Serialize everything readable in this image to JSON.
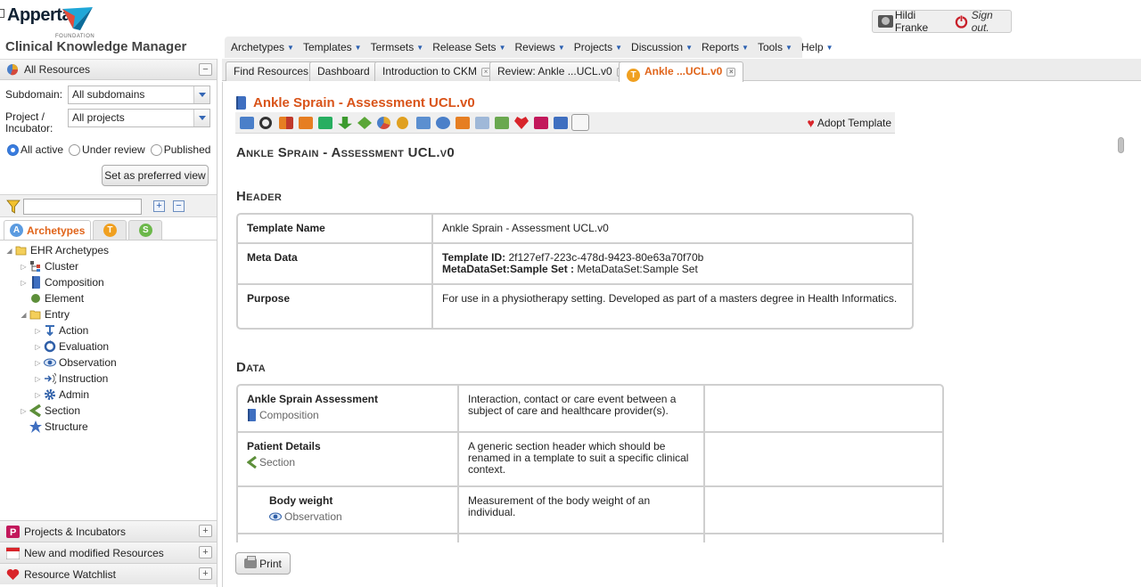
{
  "header": {
    "logo_name": "Apperta",
    "logo_foundation": "FOUNDATION",
    "app_title": "Clinical Knowledge Manager",
    "user_name": "Hildi Franke",
    "sign_out": "Sign out."
  },
  "main_menu": [
    {
      "label": "Archetypes"
    },
    {
      "label": "Templates"
    },
    {
      "label": "Termsets"
    },
    {
      "label": "Release Sets"
    },
    {
      "label": "Reviews"
    },
    {
      "label": "Projects"
    },
    {
      "label": "Discussion"
    },
    {
      "label": "Reports"
    },
    {
      "label": "Tools"
    },
    {
      "label": "Help"
    }
  ],
  "left_panel": {
    "title": "All Resources",
    "subdomain_label": "Subdomain:",
    "subdomain_value": "All subdomains",
    "project_label": "Project / Incubator:",
    "project_value": "All projects",
    "radios": [
      {
        "label": "All active",
        "checked": true
      },
      {
        "label": "Under review",
        "checked": false
      },
      {
        "label": "Published",
        "checked": false
      }
    ],
    "preferred_view_button": "Set as preferred view",
    "tabs": {
      "archetypes": "Archetypes",
      "templates_letter": "T",
      "termsets_letter": "S",
      "archetypes_letter": "A"
    },
    "tree": {
      "root": "EHR Archetypes",
      "cluster": "Cluster",
      "composition": "Composition",
      "element": "Element",
      "entry": "Entry",
      "action": "Action",
      "evaluation": "Evaluation",
      "observation": "Observation",
      "instruction": "Instruction",
      "admin": "Admin",
      "section": "Section",
      "structure": "Structure"
    },
    "bottom_panels": {
      "projects": "Projects & Incubators",
      "new_modified": "New and modified Resources",
      "watchlist": "Resource Watchlist"
    }
  },
  "doc_tabs": [
    {
      "label": "Find Resources"
    },
    {
      "label": "Dashboard"
    },
    {
      "label": "Introduction to CKM"
    },
    {
      "label": "Review: Ankle ...UCL.v0"
    },
    {
      "label": "Ankle ...UCL.v0",
      "letter": "T"
    }
  ],
  "document": {
    "title": "Ankle Sprain - Assessment UCL.v0",
    "adopt_label": "Adopt Template",
    "heading": "Ankle Sprain - Assessment UCL.v0",
    "header_section": "Header",
    "header_table": {
      "template_name_key": "Template Name",
      "template_name_value": "Ankle Sprain - Assessment UCL.v0",
      "meta_key": "Meta Data",
      "template_id_key": "Template ID:",
      "template_id_value": "2f127ef7-223c-478d-9423-80e63a70f70b",
      "metadataset_key": "MetaDataSet:Sample Set :",
      "metadataset_value": "MetaDataSet:Sample Set",
      "purpose_key": "Purpose",
      "purpose_value": "For use in a physiotherapy setting. Developed as part of a masters degree in Health Informatics."
    },
    "data_section": "Data",
    "data_rows": [
      {
        "name": "Ankle Sprain Assessment",
        "type": "Composition",
        "description": "Interaction, contact or care event between a subject of care and healthcare provider(s)."
      },
      {
        "name": "Patient Details",
        "type": "Section",
        "description": "A generic section header which should be renamed in a template to suit a specific clinical context."
      },
      {
        "name": "Body weight",
        "type": "Observation",
        "description": "Measurement of the body weight of an individual."
      }
    ],
    "print_button": "Print"
  },
  "colors": {
    "accent_orange": "#d9541a",
    "menu_caret": "#2a5fb0"
  }
}
